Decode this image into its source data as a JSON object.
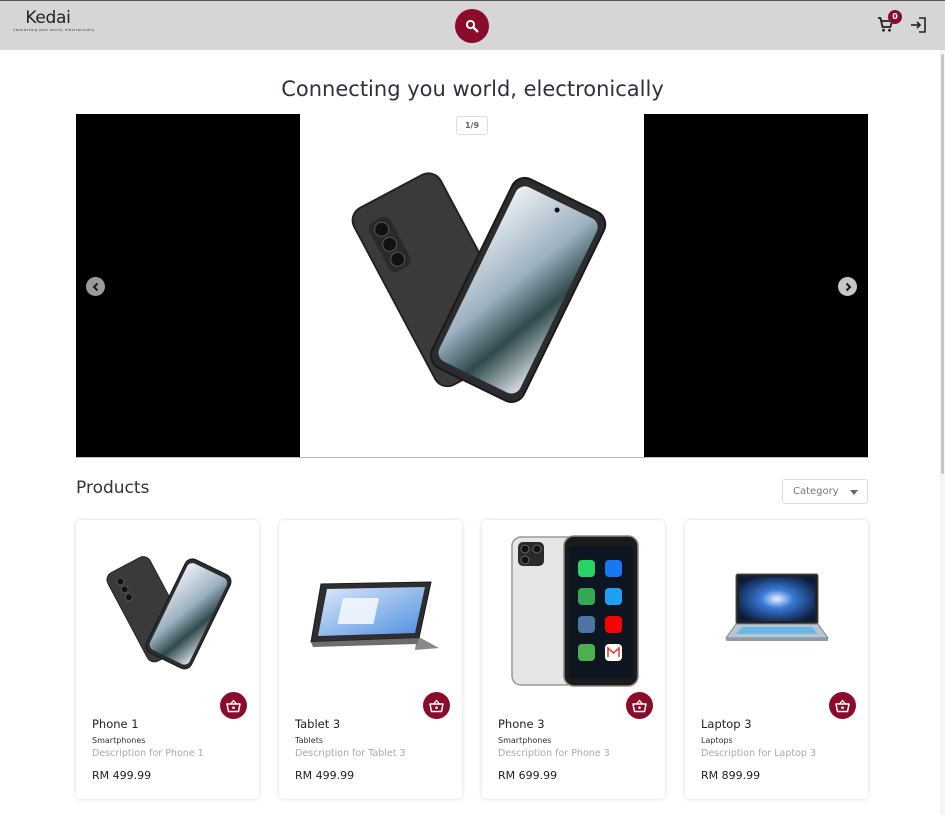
{
  "header": {
    "logo": {
      "name": "Kedai",
      "tagline": "Connecting your world, electronically"
    },
    "cart_count": "0",
    "icons": {
      "search": "search-icon",
      "cart": "cart-icon",
      "login": "login-icon"
    }
  },
  "hero": {
    "title": "Connecting you world, electronically",
    "counter": "1/9"
  },
  "products": {
    "title": "Products",
    "category_placeholder": "Category",
    "items": [
      {
        "name": "Phone 1",
        "category": "Smartphones",
        "description": "Description for Phone 1",
        "price": "RM 499.99",
        "image": "phone-image"
      },
      {
        "name": "Tablet 3",
        "category": "Tablets",
        "description": "Description for Tablet 3",
        "price": "RM 499.99",
        "image": "tablet-image"
      },
      {
        "name": "Phone 3",
        "category": "Smartphones",
        "description": "Description for Phone 3",
        "price": "RM 699.99",
        "image": "mini-phone-image"
      },
      {
        "name": "Laptop 3",
        "category": "Laptops",
        "description": "Description for Laptop 3",
        "price": "RM 899.99",
        "image": "laptop-image"
      }
    ]
  },
  "colors": {
    "accent": "#8b0b2a",
    "header_bg": "#d6d6d6"
  }
}
